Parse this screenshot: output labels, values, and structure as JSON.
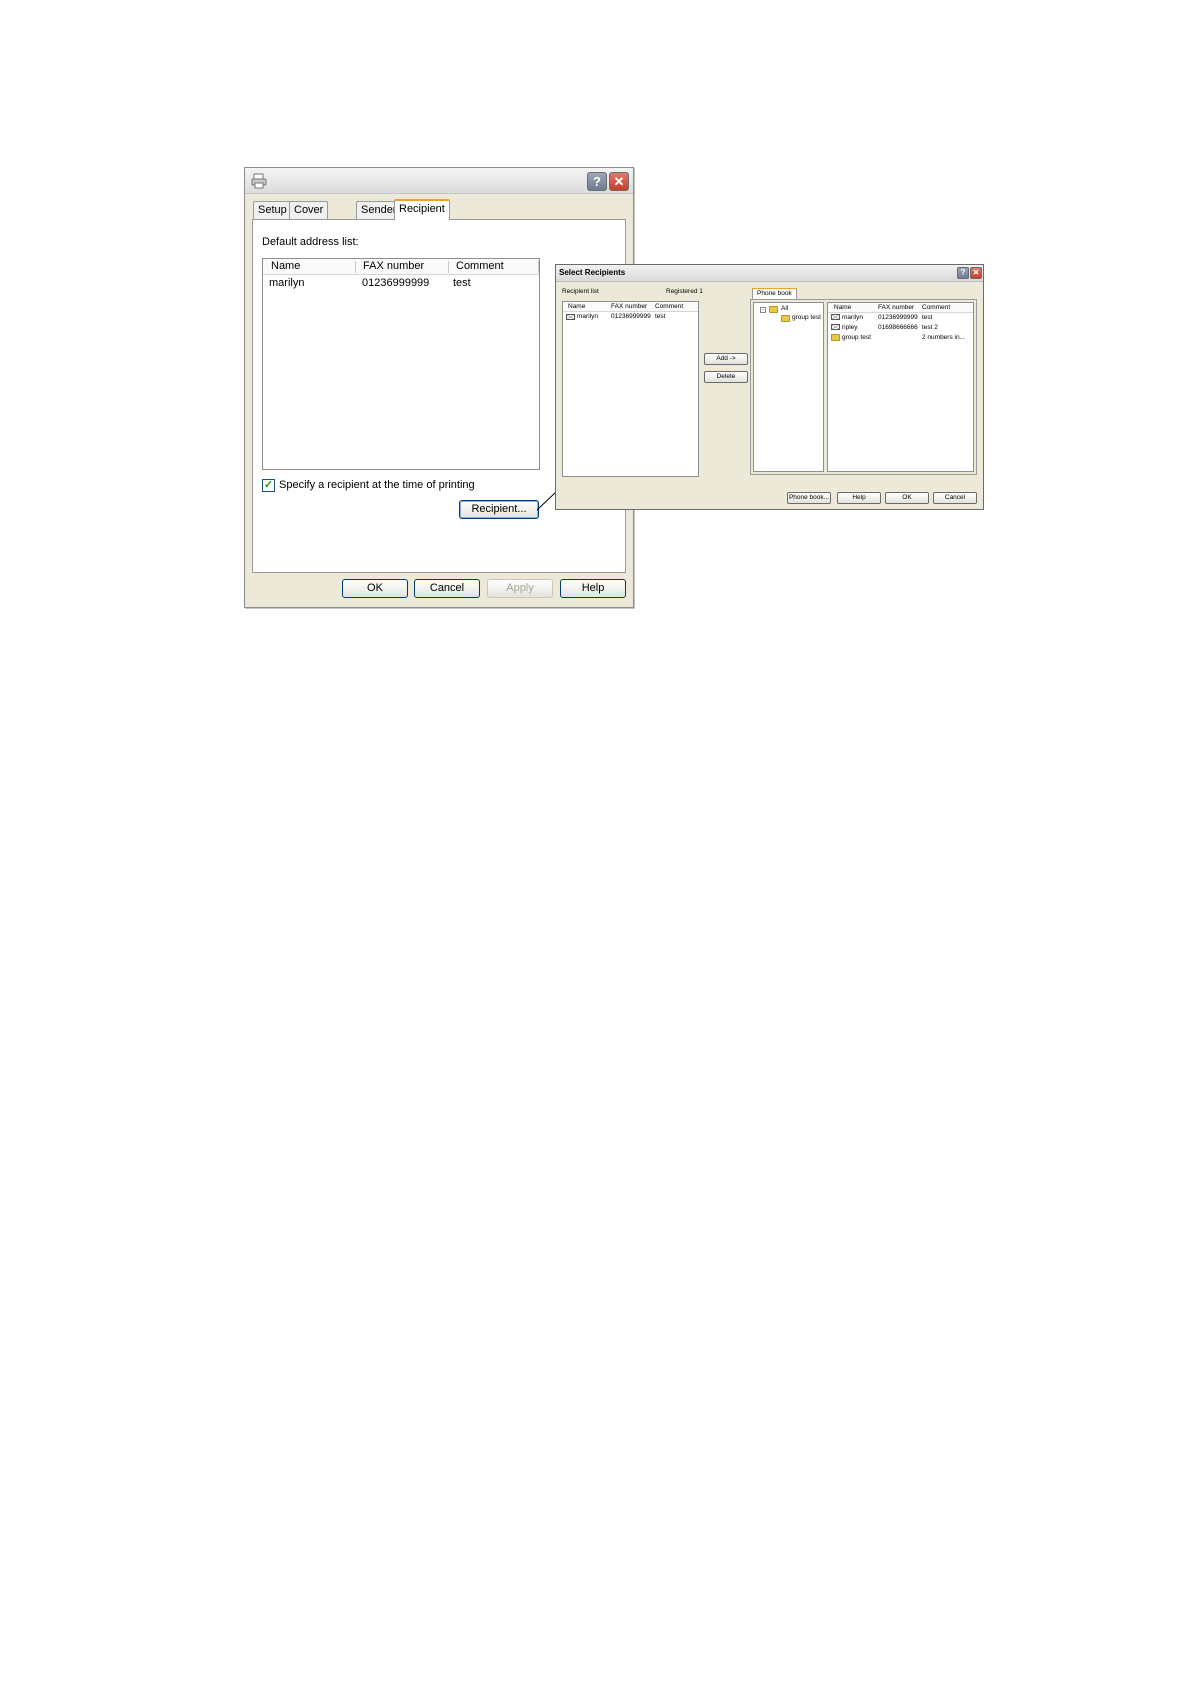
{
  "dialog": {
    "tabs": [
      {
        "label": "Setup"
      },
      {
        "label": "Cover Sheet"
      },
      {
        "label": "Sender"
      },
      {
        "label": "Recipient"
      }
    ],
    "default_address_label": "Default address list:",
    "columns": {
      "name": "Name",
      "fax": "FAX number",
      "comment": "Comment"
    },
    "rows": [
      {
        "name": "marilyn",
        "fax": "01236999999",
        "comment": "test"
      }
    ],
    "checkbox": {
      "label": "Specify a recipient at the time of printing",
      "checked": true
    },
    "recipient_button": "Recipient...",
    "buttons": {
      "ok": "OK",
      "cancel": "Cancel",
      "apply": "Apply",
      "help": "Help"
    }
  },
  "select_recipients": {
    "title": "Select Recipients",
    "recipient_list_label": "Recipient list",
    "registered_label": "Registered 1",
    "columns": {
      "name": "Name",
      "fax": "FAX number",
      "comment": "Comment"
    },
    "recipients": [
      {
        "name": "marilyn",
        "fax": "01236999999",
        "comment": "test"
      }
    ],
    "add_button": "Add ->",
    "delete_button": "Delete",
    "phone_book_tab": "Phone book",
    "tree": {
      "root": "All",
      "child": "group test"
    },
    "phone_book": [
      {
        "name": "marilyn",
        "fax": "01236999999",
        "comment": "test",
        "icon": "mail-icon"
      },
      {
        "name": "ripley",
        "fax": "01698666666",
        "comment": "test 2",
        "icon": "mail-icon"
      },
      {
        "name": "group test",
        "fax": "",
        "comment": "2 numbers in...",
        "icon": "folder-icon"
      }
    ],
    "buttons": {
      "phone_book": "Phone book...",
      "help": "Help",
      "ok": "OK",
      "cancel": "Cancel"
    }
  },
  "colors": {
    "tab_highlight": "#f0a030",
    "dialog_bg": "#ece9d8",
    "checkmark": "#21a121",
    "close_button": "#c0402a"
  }
}
